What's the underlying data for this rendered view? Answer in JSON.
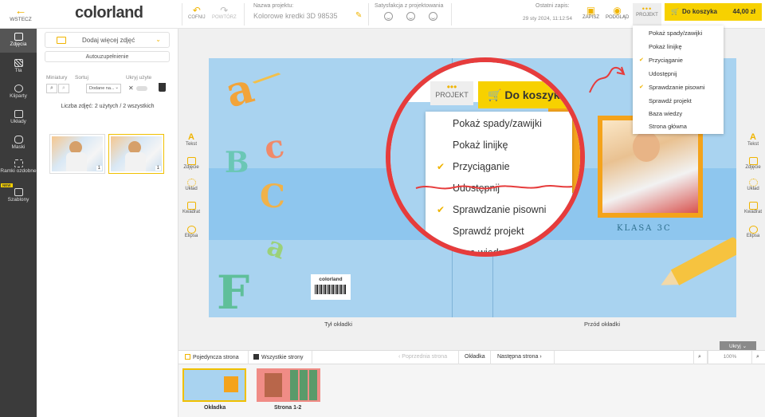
{
  "topbar": {
    "back": "WSTECZ",
    "logo": "colorland",
    "undo": "COFNIJ",
    "redo": "POWTÓRZ",
    "project_name_label": "Nazwa projektu:",
    "project_name": "Kolorowe kredki 3D 98535",
    "satisfaction_label": "Satysfakcja z projektowania",
    "last_saved_label": "Ostatni zapis:",
    "last_saved": "29 sty 2024, 11:12:54",
    "save": "ZAPISZ",
    "preview": "PODGLĄD",
    "project": "PROJEKT",
    "cart": "Do koszyka",
    "price": "44,00 zł"
  },
  "rail": {
    "items": [
      "Zdjęcia",
      "Tła",
      "Kliparty",
      "Układy",
      "Maski",
      "Ramki ozdobne",
      "Szablony"
    ],
    "new_badge": "NEW"
  },
  "panel": {
    "add_photos": "Dodaj więcej zdjęć",
    "autofill": "Autouzupełnienie",
    "thumbnails_label": "Miniatury",
    "sort_label": "Sortuj",
    "sort_value": "Dodane na...",
    "hide_used_label": "Ukryj użyte",
    "photo_count": "Liczba zdjęć: 2 użytych / 2 wszystkich",
    "thumbs": [
      {
        "num": "1"
      },
      {
        "num": "1"
      }
    ]
  },
  "tools": [
    "Tekst",
    "Zdjęcie",
    "Układ",
    "Kwadrat",
    "Elipsa"
  ],
  "cover": {
    "brand": "colorland",
    "class_label": "KLASA 3C",
    "back_label": "Tył okładki",
    "front_label": "Przód okładki"
  },
  "menu": {
    "items": [
      {
        "label": "Pokaż spady/zawijki",
        "checked": false
      },
      {
        "label": "Pokaż linijkę",
        "checked": false
      },
      {
        "label": "Przyciąganie",
        "checked": true
      },
      {
        "label": "Udostępnij",
        "checked": false
      },
      {
        "label": "Sprawdzanie pisowni",
        "checked": true
      },
      {
        "label": "Sprawdź projekt",
        "checked": false
      },
      {
        "label": "Baza wiedzy",
        "checked": false
      },
      {
        "label": "Strona główna",
        "checked": false
      }
    ]
  },
  "magnifier": {
    "project": "PROJEKT",
    "cart": "Do koszyka"
  },
  "pagebar": {
    "single": "Pojedyncza strona",
    "all": "Wszystkie strony",
    "prev": "Poprzednia strona",
    "current": "Okładka",
    "next": "Następna strona",
    "zoom": "100%",
    "hide": "Ukryj"
  },
  "pages": [
    "Okładka",
    "Strona 1-2"
  ],
  "colors": {
    "accent": "#f7d100",
    "highlight": "#e63c3c",
    "cover_bg": "#a9d3f0"
  }
}
